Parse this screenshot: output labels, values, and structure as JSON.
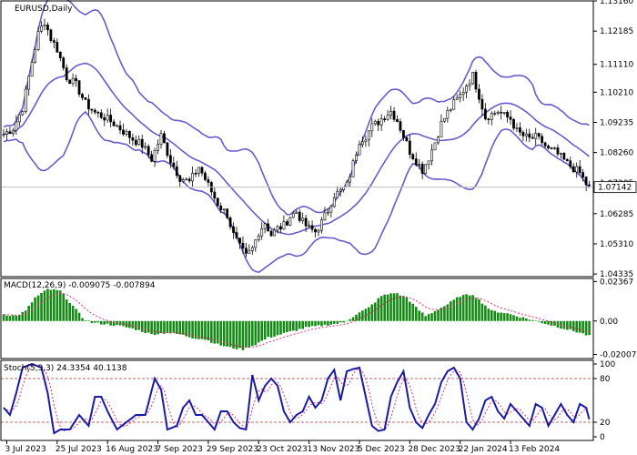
{
  "chart_data": {
    "type": "candlestick",
    "symbol_label": "EURUSD,Daily",
    "current_price": "1.07142",
    "price_axis": {
      "ylim": [
        1.0425,
        1.1316
      ],
      "ticks": [
        "1.13160",
        "1.12185",
        "1.11110",
        "1.10210",
        "1.09235",
        "1.08260",
        "1.07285",
        "1.06285",
        "1.05310",
        "1.04335"
      ]
    },
    "x_labels": [
      "3 Jul 2023",
      "25 Jul 2023",
      "16 Aug 2023",
      "7 Sep 2023",
      "29 Sep 2023",
      "23 Oct 2023",
      "13 Nov 2023",
      "5 Dec 2023",
      "28 Dec 2023",
      "22 Jan 2024",
      "13 Feb 2024"
    ],
    "price_anchors": [
      [
        0,
        1.0885
      ],
      [
        3,
        1.0905
      ],
      [
        6,
        1.097
      ],
      [
        9,
        1.112
      ],
      [
        11,
        1.121
      ],
      [
        13,
        1.125
      ],
      [
        15,
        1.1195
      ],
      [
        17,
        1.116
      ],
      [
        20,
        1.107
      ],
      [
        23,
        1.1045
      ],
      [
        26,
        1.0985
      ],
      [
        29,
        1.0955
      ],
      [
        32,
        1.094
      ],
      [
        35,
        1.092
      ],
      [
        38,
        1.0895
      ],
      [
        41,
        1.087
      ],
      [
        44,
        1.085
      ],
      [
        47,
        1.0805
      ],
      [
        50,
        1.088
      ],
      [
        53,
        1.08
      ],
      [
        56,
        1.0745
      ],
      [
        59,
        1.073
      ],
      [
        62,
        1.078
      ],
      [
        65,
        1.072
      ],
      [
        68,
        1.066
      ],
      [
        71,
        1.0625
      ],
      [
        73,
        1.056
      ],
      [
        75,
        1.052
      ],
      [
        77,
        1.049
      ],
      [
        79,
        1.0515
      ],
      [
        81,
        1.057
      ],
      [
        83,
        1.06
      ],
      [
        85,
        1.056
      ],
      [
        87,
        1.058
      ],
      [
        89,
        1.059
      ],
      [
        91,
        1.062
      ],
      [
        93,
        1.0635
      ],
      [
        95,
        1.06
      ],
      [
        97,
        1.058
      ],
      [
        99,
        1.057
      ],
      [
        101,
        1.06
      ],
      [
        103,
        1.064
      ],
      [
        105,
        1.069
      ],
      [
        107,
        1.07
      ],
      [
        109,
        1.072
      ],
      [
        111,
        1.079
      ],
      [
        113,
        1.0865
      ],
      [
        115,
        1.088
      ],
      [
        117,
        1.091
      ],
      [
        119,
        1.0925
      ],
      [
        121,
        1.0945
      ],
      [
        123,
        1.096
      ],
      [
        125,
        1.093
      ],
      [
        127,
        1.088
      ],
      [
        129,
        1.083
      ],
      [
        131,
        1.08
      ],
      [
        133,
        1.077
      ],
      [
        135,
        1.081
      ],
      [
        137,
        1.086
      ],
      [
        139,
        1.092
      ],
      [
        141,
        1.0955
      ],
      [
        143,
        1.0985
      ],
      [
        145,
        1.101
      ],
      [
        147,
        1.1045
      ],
      [
        149,
        1.1075
      ],
      [
        151,
        1.101
      ],
      [
        153,
        1.094
      ],
      [
        155,
        1.095
      ],
      [
        157,
        1.096
      ],
      [
        159,
        1.0945
      ],
      [
        161,
        1.0935
      ],
      [
        163,
        1.0895
      ],
      [
        165,
        1.088
      ],
      [
        167,
        1.087
      ],
      [
        169,
        1.0875
      ],
      [
        171,
        1.086
      ],
      [
        173,
        1.0835
      ],
      [
        175,
        1.083
      ],
      [
        177,
        1.081
      ],
      [
        179,
        1.079
      ],
      [
        181,
        1.0775
      ],
      [
        183,
        1.076
      ],
      [
        185,
        1.0725
      ],
      [
        186,
        1.0714
      ]
    ],
    "bollinger_bands": {
      "name": "",
      "period": 20,
      "deviations": 2
    },
    "macd": {
      "label": "MACD(12,26,9) -0.009075 -0.007894",
      "ylim": [
        -0.0225,
        0.0255
      ],
      "ticks": [
        "0.02367",
        "0.00",
        "-0.020075"
      ],
      "histogram_anchors": [
        [
          0,
          0.004
        ],
        [
          4,
          0.003
        ],
        [
          7,
          0.006
        ],
        [
          10,
          0.014
        ],
        [
          14,
          0.019
        ],
        [
          18,
          0.018
        ],
        [
          22,
          0.009
        ],
        [
          25,
          0.002
        ],
        [
          28,
          -0.001
        ],
        [
          33,
          -0.002
        ],
        [
          37,
          -0.003
        ],
        [
          42,
          -0.005
        ],
        [
          47,
          -0.008
        ],
        [
          52,
          -0.007
        ],
        [
          56,
          -0.008
        ],
        [
          60,
          -0.01
        ],
        [
          64,
          -0.011
        ],
        [
          68,
          -0.014
        ],
        [
          72,
          -0.016
        ],
        [
          76,
          -0.017
        ],
        [
          80,
          -0.014
        ],
        [
          84,
          -0.01
        ],
        [
          88,
          -0.008
        ],
        [
          92,
          -0.006
        ],
        [
          96,
          -0.004
        ],
        [
          100,
          -0.003
        ],
        [
          104,
          -0.002
        ],
        [
          108,
          -0.001
        ],
        [
          112,
          0.004
        ],
        [
          116,
          0.008
        ],
        [
          120,
          0.015
        ],
        [
          124,
          0.017
        ],
        [
          128,
          0.014
        ],
        [
          131,
          0.008
        ],
        [
          134,
          0.003
        ],
        [
          137,
          0.006
        ],
        [
          141,
          0.01
        ],
        [
          145,
          0.015
        ],
        [
          149,
          0.016
        ],
        [
          152,
          0.011
        ],
        [
          155,
          0.006
        ],
        [
          159,
          0.005
        ],
        [
          163,
          0.003
        ],
        [
          167,
          0.001
        ],
        [
          171,
          -0.001
        ],
        [
          175,
          -0.003
        ],
        [
          179,
          -0.005
        ],
        [
          183,
          -0.007
        ],
        [
          186,
          -0.009
        ]
      ]
    },
    "stochastic": {
      "label": "Stoch(5,3,3) 24.3354 40.1138",
      "ylim": [
        0,
        100
      ],
      "ticks": [
        "100",
        "80",
        "20",
        "0"
      ],
      "levels": [
        80,
        20
      ],
      "k_anchors": [
        [
          0,
          40
        ],
        [
          2,
          30
        ],
        [
          4,
          60
        ],
        [
          6,
          95
        ],
        [
          9,
          100
        ],
        [
          12,
          95
        ],
        [
          14,
          60
        ],
        [
          16,
          5
        ],
        [
          18,
          10
        ],
        [
          21,
          10
        ],
        [
          24,
          30
        ],
        [
          27,
          15
        ],
        [
          29,
          55
        ],
        [
          31,
          55
        ],
        [
          33,
          35
        ],
        [
          36,
          10
        ],
        [
          39,
          20
        ],
        [
          42,
          30
        ],
        [
          45,
          30
        ],
        [
          48,
          80
        ],
        [
          50,
          65
        ],
        [
          52,
          10
        ],
        [
          55,
          15
        ],
        [
          57,
          40
        ],
        [
          59,
          50
        ],
        [
          61,
          30
        ],
        [
          63,
          30
        ],
        [
          65,
          20
        ],
        [
          67,
          10
        ],
        [
          69,
          35
        ],
        [
          71,
          35
        ],
        [
          73,
          20
        ],
        [
          75,
          12
        ],
        [
          77,
          10
        ],
        [
          79,
          85
        ],
        [
          81,
          50
        ],
        [
          83,
          70
        ],
        [
          85,
          80
        ],
        [
          87,
          70
        ],
        [
          89,
          35
        ],
        [
          91,
          20
        ],
        [
          93,
          30
        ],
        [
          95,
          35
        ],
        [
          97,
          55
        ],
        [
          99,
          40
        ],
        [
          101,
          50
        ],
        [
          103,
          80
        ],
        [
          105,
          92
        ],
        [
          107,
          50
        ],
        [
          109,
          90
        ],
        [
          111,
          93
        ],
        [
          113,
          95
        ],
        [
          115,
          55
        ],
        [
          117,
          15
        ],
        [
          119,
          8
        ],
        [
          121,
          10
        ],
        [
          123,
          55
        ],
        [
          125,
          75
        ],
        [
          127,
          90
        ],
        [
          129,
          40
        ],
        [
          131,
          20
        ],
        [
          133,
          12
        ],
        [
          135,
          30
        ],
        [
          137,
          45
        ],
        [
          139,
          75
        ],
        [
          141,
          90
        ],
        [
          143,
          95
        ],
        [
          145,
          80
        ],
        [
          147,
          20
        ],
        [
          149,
          10
        ],
        [
          151,
          25
        ],
        [
          153,
          50
        ],
        [
          155,
          55
        ],
        [
          157,
          35
        ],
        [
          159,
          25
        ],
        [
          161,
          45
        ],
        [
          163,
          35
        ],
        [
          165,
          25
        ],
        [
          167,
          15
        ],
        [
          169,
          45
        ],
        [
          171,
          40
        ],
        [
          173,
          15
        ],
        [
          175,
          30
        ],
        [
          177,
          45
        ],
        [
          179,
          30
        ],
        [
          181,
          20
        ],
        [
          183,
          45
        ],
        [
          185,
          40
        ],
        [
          186,
          24
        ]
      ]
    }
  }
}
